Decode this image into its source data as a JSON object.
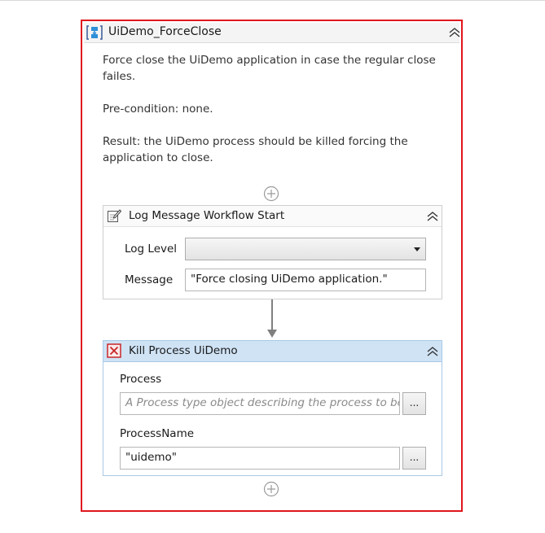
{
  "sequence": {
    "title": "UiDemo_ForceClose",
    "annotation": [
      "Force close the UiDemo application in case the regular close failes.",
      "Pre-condition: none.",
      "Result: the UiDemo process should be killed forcing the application to close."
    ],
    "icon": "sequence-icon"
  },
  "log_message": {
    "title": "Log Message Workflow Start",
    "icon": "log-message-icon",
    "level_label": "Log Level",
    "level_value": "",
    "message_label": "Message",
    "message_value": "\"Force closing UiDemo application.\""
  },
  "kill_process": {
    "title": "Kill Process UiDemo",
    "icon": "kill-process-icon",
    "process_label": "Process",
    "process_placeholder": "A Process type object describing the process to be cl",
    "process_name_label": "ProcessName",
    "process_name_value": "\"uidemo\"",
    "browse_label": "...",
    "accent_color": "#cfe3f5"
  },
  "colors": {
    "selection_border": "#e0161e",
    "connector": "#808080"
  }
}
